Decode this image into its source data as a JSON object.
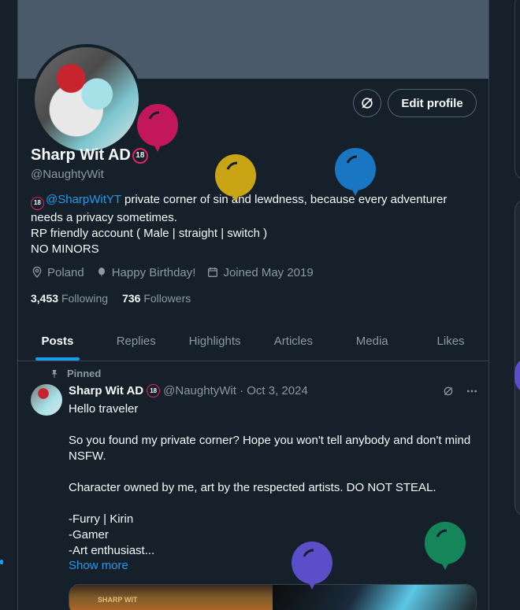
{
  "profile": {
    "display_name": "Sharp Wit AD",
    "age_badge": "18",
    "handle": "@NaughtyWit",
    "edit_profile_label": "Edit profile",
    "bio": {
      "mention": "@SharpWitYT",
      "line1_rest": " private corner of sin and lewdness, because every adventurer needs a privacy sometimes.",
      "line2": "RP friendly account ( Male | straight | switch )",
      "line3": "NO MINORS"
    },
    "location": "Poland",
    "birthday": "Happy Birthday!",
    "joined": "Joined May 2019",
    "following_count": "3,453",
    "following_label": "Following",
    "followers_count": "736",
    "followers_label": "Followers"
  },
  "tabs": [
    {
      "label": "Posts",
      "active": true
    },
    {
      "label": "Replies",
      "active": false
    },
    {
      "label": "Highlights",
      "active": false
    },
    {
      "label": "Articles",
      "active": false
    },
    {
      "label": "Media",
      "active": false
    },
    {
      "label": "Likes",
      "active": false
    }
  ],
  "pinned_post": {
    "pinned_label": "Pinned",
    "author": "Sharp Wit AD",
    "age_badge": "18",
    "meta": "@NaughtyWit · Oct 3, 2024",
    "body": "Hello traveler\n\nSo you found my private corner? Hope you won't tell anybody and don't mind NSFW.\n\nCharacter owned by me, art by the respected artists. DO NOT STEAL.\n\n-Furry | Kirin\n-Gamer\n-Art enthusiast...",
    "show_more": "Show more",
    "media_caption": "SHARP WIT"
  },
  "colors": {
    "background": "#15202b",
    "accent": "#1d9bf0",
    "badge_ring": "#e0245e",
    "balloons": [
      "#c2185b",
      "#c9a516",
      "#1976c2",
      "#5b4ec8",
      "#15855a"
    ]
  }
}
